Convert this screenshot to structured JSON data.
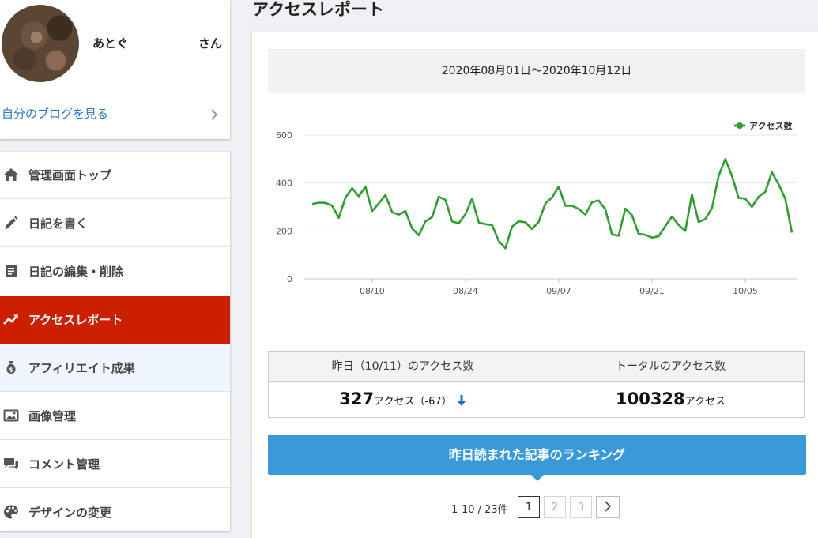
{
  "profile": {
    "name": "あとぐ",
    "suffix": "さん",
    "blog_link": "自分のブログを見る"
  },
  "nav": [
    {
      "label": "管理画面トップ",
      "icon": "home-icon"
    },
    {
      "label": "日記を書く",
      "icon": "pencil-icon"
    },
    {
      "label": "日記の編集・削除",
      "icon": "document-icon"
    },
    {
      "label": "アクセスレポート",
      "icon": "trend-icon",
      "active": true
    },
    {
      "label": "アフィリエイト成果",
      "icon": "money-bag-icon"
    },
    {
      "label": "画像管理",
      "icon": "image-icon"
    },
    {
      "label": "コメント管理",
      "icon": "comment-icon"
    },
    {
      "label": "デザインの変更",
      "icon": "palette-icon"
    }
  ],
  "page_title": "アクセスレポート",
  "date_range": "2020年08月01日～2020年10月12日",
  "chart_data": {
    "type": "line",
    "legend": "アクセス数",
    "legend_position": "top-right",
    "color": "#2ca02c",
    "ylim": [
      0,
      600
    ],
    "yticks": [
      "0",
      "200",
      "400",
      "600"
    ],
    "xtick_labels": [
      {
        "label": "08/10",
        "day": 9
      },
      {
        "label": "08/24",
        "day": 23
      },
      {
        "label": "09/07",
        "day": 37
      },
      {
        "label": "09/21",
        "day": 51
      },
      {
        "label": "10/05",
        "day": 65
      }
    ],
    "series": [
      {
        "name": "アクセス数",
        "start": "2020-08-01",
        "values": [
          313,
          318,
          317,
          305,
          255,
          340,
          378,
          345,
          385,
          283,
          315,
          350,
          278,
          268,
          283,
          210,
          182,
          240,
          258,
          343,
          330,
          240,
          232,
          270,
          335,
          235,
          228,
          225,
          158,
          128,
          218,
          240,
          236,
          208,
          238,
          315,
          340,
          385,
          305,
          305,
          292,
          268,
          320,
          327,
          290,
          185,
          180,
          293,
          265,
          188,
          184,
          172,
          178,
          220,
          260,
          225,
          200,
          352,
          237,
          250,
          295,
          430,
          500,
          430,
          338,
          335,
          300,
          343,
          363,
          445,
          395,
          335,
          193
        ]
      }
    ]
  },
  "stats": {
    "yesterday_header": "昨日（10/11）のアクセス数",
    "yesterday_value": "327",
    "yesterday_unit": "アクセス（-67）",
    "total_header": "トータルのアクセス数",
    "total_value": "100328",
    "total_unit": "アクセス"
  },
  "ranking_button": "昨日読まれた記事のランキング",
  "pager": {
    "summary": "1-10 / 23件",
    "pages": [
      "1",
      "2",
      "3"
    ],
    "current": "1",
    "next": ">"
  }
}
